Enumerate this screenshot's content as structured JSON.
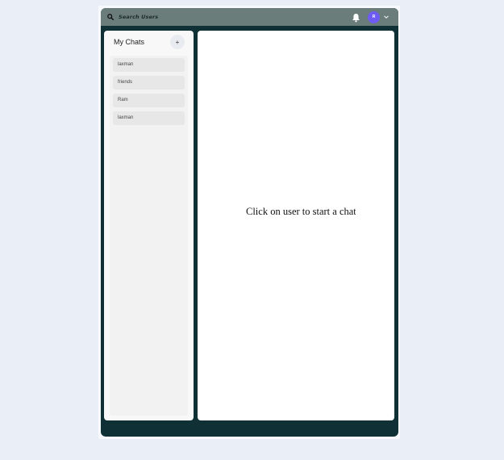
{
  "header": {
    "search_label": "Search Users",
    "avatar_initial": "R",
    "accent_color": "#6d5bf3",
    "icons": [
      "search-icon",
      "bell-icon",
      "chevron-down-icon"
    ]
  },
  "sidebar": {
    "title": "My Chats",
    "add_label": "+",
    "chats": [
      {
        "label": "laxman"
      },
      {
        "label": "friends"
      },
      {
        "label": "Ram"
      },
      {
        "label": "laxman"
      }
    ]
  },
  "main": {
    "empty_message": "Click on user to start a chat"
  },
  "colors": {
    "background": "#eaeef6",
    "app_background": "#0f3135",
    "topbar": "#6b7d7b"
  }
}
